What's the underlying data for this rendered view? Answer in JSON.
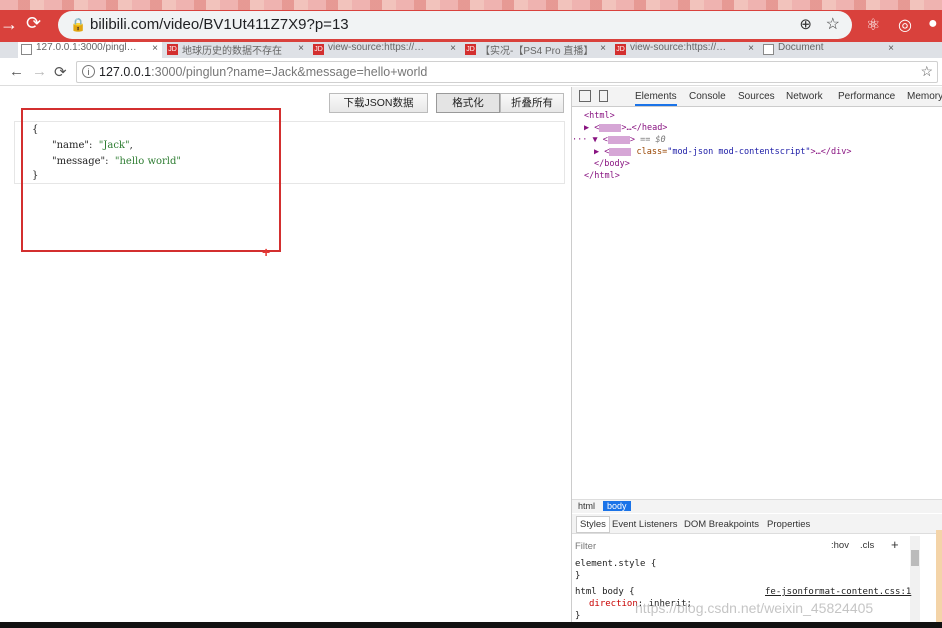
{
  "outer": {
    "url": "bilibili.com/video/BV1Ut411Z7X9?p=13"
  },
  "tabs": [
    {
      "label": "127.0.0.1:3000/pingl…",
      "active": true
    },
    {
      "label": "地球历史的数据不存在"
    },
    {
      "label": "view-source:https://…"
    },
    {
      "label": "【实况-【PS4 Pro 直播】"
    },
    {
      "label": "view-source:https://…"
    },
    {
      "label": "Document"
    }
  ],
  "inner": {
    "url_host": "127.0.0.1",
    "url_rest": ":3000/pinglun?name=Jack&message=hello+world"
  },
  "toolbar": {
    "download_label": "下载JSON数据",
    "format_label": "格式化",
    "collapse_label": "折叠所有"
  },
  "json_view": {
    "open": "{",
    "key1": "\"name\"",
    "val1": "\"Jack\"",
    "key2": "\"message\"",
    "val2": "\"hello world\"",
    "close": "}"
  },
  "devtools": {
    "tabs": [
      "Elements",
      "Console",
      "Sources",
      "Network",
      "Performance",
      "Memory"
    ],
    "active_tab": "Elements",
    "lines": {
      "l1": "<html>",
      "l2_tail": "…</head>",
      "l3_tail": "== $0",
      "l4_attr": "class=",
      "l4_val": "\"mod-json mod-contentscript\"",
      "l4_tail": ">…</div>",
      "l5": "</body>",
      "l6": "</html>"
    },
    "crumbs": [
      "html",
      "body"
    ],
    "style_tabs": [
      "Styles",
      "Event Listeners",
      "DOM Breakpoints",
      "Properties"
    ],
    "filter_placeholder": "Filter",
    "hov": ":hov",
    "cls": ".cls",
    "plus": "+",
    "styles": {
      "element_style": "element.style {",
      "close1": "}",
      "rule": "html body {",
      "source": "fe-jsonformat-content.css:1",
      "prop": "direction",
      "value": "inherit;",
      "close2": "}"
    }
  },
  "watermark": "https://blog.csdn.net/weixin_45824405"
}
